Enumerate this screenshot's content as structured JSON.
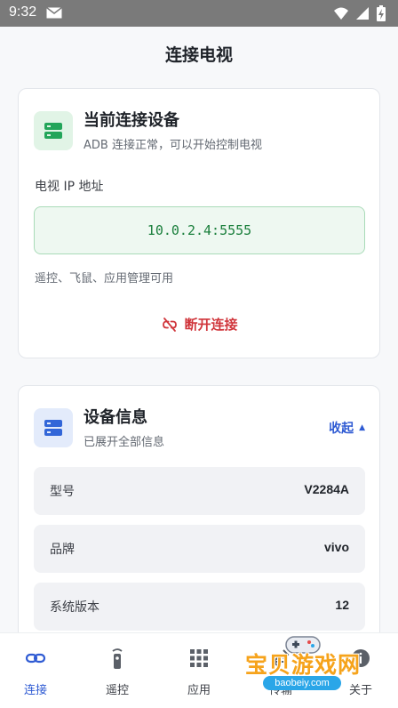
{
  "status_bar": {
    "time": "9:32"
  },
  "header": {
    "title": "连接电视"
  },
  "connection_card": {
    "title": "当前连接设备",
    "subtitle": "ADB 连接正常，可以开始控制电视",
    "ip_label": "电视 IP 地址",
    "ip_value": "10.0.2.4:5555",
    "hint": "遥控、飞鼠、应用管理可用",
    "disconnect_label": "断开连接"
  },
  "device_card": {
    "title": "设备信息",
    "subtitle": "已展开全部信息",
    "collapse_label": "收起",
    "rows": [
      {
        "key": "型号",
        "value": "V2284A"
      },
      {
        "key": "品牌",
        "value": "vivo"
      },
      {
        "key": "系统版本",
        "value": "12"
      }
    ]
  },
  "bottom_nav": {
    "items": [
      {
        "label": "连接",
        "icon": "link-icon",
        "active": true
      },
      {
        "label": "遥控",
        "icon": "remote-icon",
        "active": false
      },
      {
        "label": "应用",
        "icon": "grid-icon",
        "active": false
      },
      {
        "label": "传输",
        "icon": "transfer-icon",
        "active": false
      },
      {
        "label": "关于",
        "icon": "info-icon",
        "active": false
      }
    ]
  },
  "watermark": {
    "text": "宝贝游戏网",
    "url": "baobeiy.com"
  },
  "colors": {
    "accent": "#2f5bd3",
    "success": "#1a7f3c",
    "danger": "#d0353b",
    "success_bg": "#eef8f1"
  }
}
